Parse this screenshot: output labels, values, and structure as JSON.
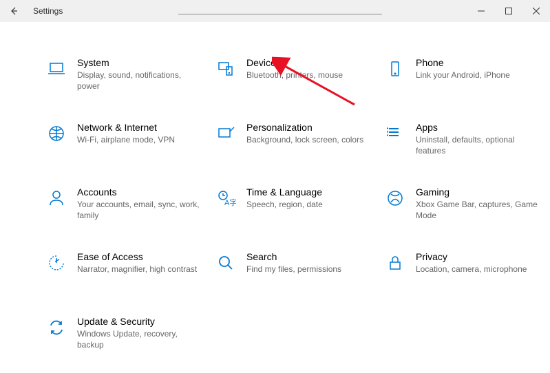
{
  "window": {
    "title": "Settings"
  },
  "tiles": [
    {
      "title": "System",
      "desc": "Display, sound, notifications, power"
    },
    {
      "title": "Devices",
      "desc": "Bluetooth, printers, mouse"
    },
    {
      "title": "Phone",
      "desc": "Link your Android, iPhone"
    },
    {
      "title": "Network & Internet",
      "desc": "Wi-Fi, airplane mode, VPN"
    },
    {
      "title": "Personalization",
      "desc": "Background, lock screen, colors"
    },
    {
      "title": "Apps",
      "desc": "Uninstall, defaults, optional features"
    },
    {
      "title": "Accounts",
      "desc": "Your accounts, email, sync, work, family"
    },
    {
      "title": "Time & Language",
      "desc": "Speech, region, date"
    },
    {
      "title": "Gaming",
      "desc": "Xbox Game Bar, captures, Game Mode"
    },
    {
      "title": "Ease of Access",
      "desc": "Narrator, magnifier, high contrast"
    },
    {
      "title": "Search",
      "desc": "Find my files, permissions"
    },
    {
      "title": "Privacy",
      "desc": "Location, camera, microphone"
    },
    {
      "title": "Update & Security",
      "desc": "Windows Update, recovery, backup"
    }
  ]
}
